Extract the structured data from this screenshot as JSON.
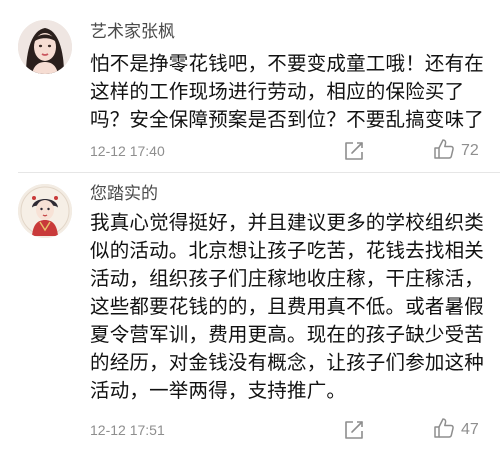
{
  "comments": [
    {
      "username": "艺术家张枫",
      "avatar_icon": "user-avatar-woman-photo",
      "lines": [
        "怕不是挣零花钱吧，不要变成童工哦！还有在",
        "这样的工作现场进行劳动，相应的保险买了",
        "吗？安全保障预案是否到位？不要乱搞变味了"
      ],
      "timestamp": "12-12 17:40",
      "share_icon": "share-edit-icon",
      "like_icon": "thumbs-up-icon",
      "likes": "72"
    },
    {
      "username": "您踏实的",
      "avatar_icon": "user-avatar-illustration",
      "lines": [
        "我真心觉得挺好，并且建议更多的学校组织类",
        "似的活动。北京想让孩子吃苦，花钱去找相关",
        "活动，组织孩子们庄稼地收庄稼，干庄稼活，",
        "这些都要花钱的的，且费用真不低。或者暑假",
        "夏令营军训，费用更高。现在的孩子缺少受苦",
        "的经历，对金钱没有概念，让孩子们参加这种",
        "活动，一举两得，支持推广。"
      ],
      "timestamp": "12-12 17:51",
      "share_icon": "share-edit-icon",
      "like_icon": "thumbs-up-icon",
      "likes": "47"
    }
  ],
  "colors": {
    "username": "#4a4a4a",
    "body_text": "#111111",
    "meta_text": "#8e8e8e",
    "divider": "#e6e6e6",
    "background": "#ffffff"
  }
}
